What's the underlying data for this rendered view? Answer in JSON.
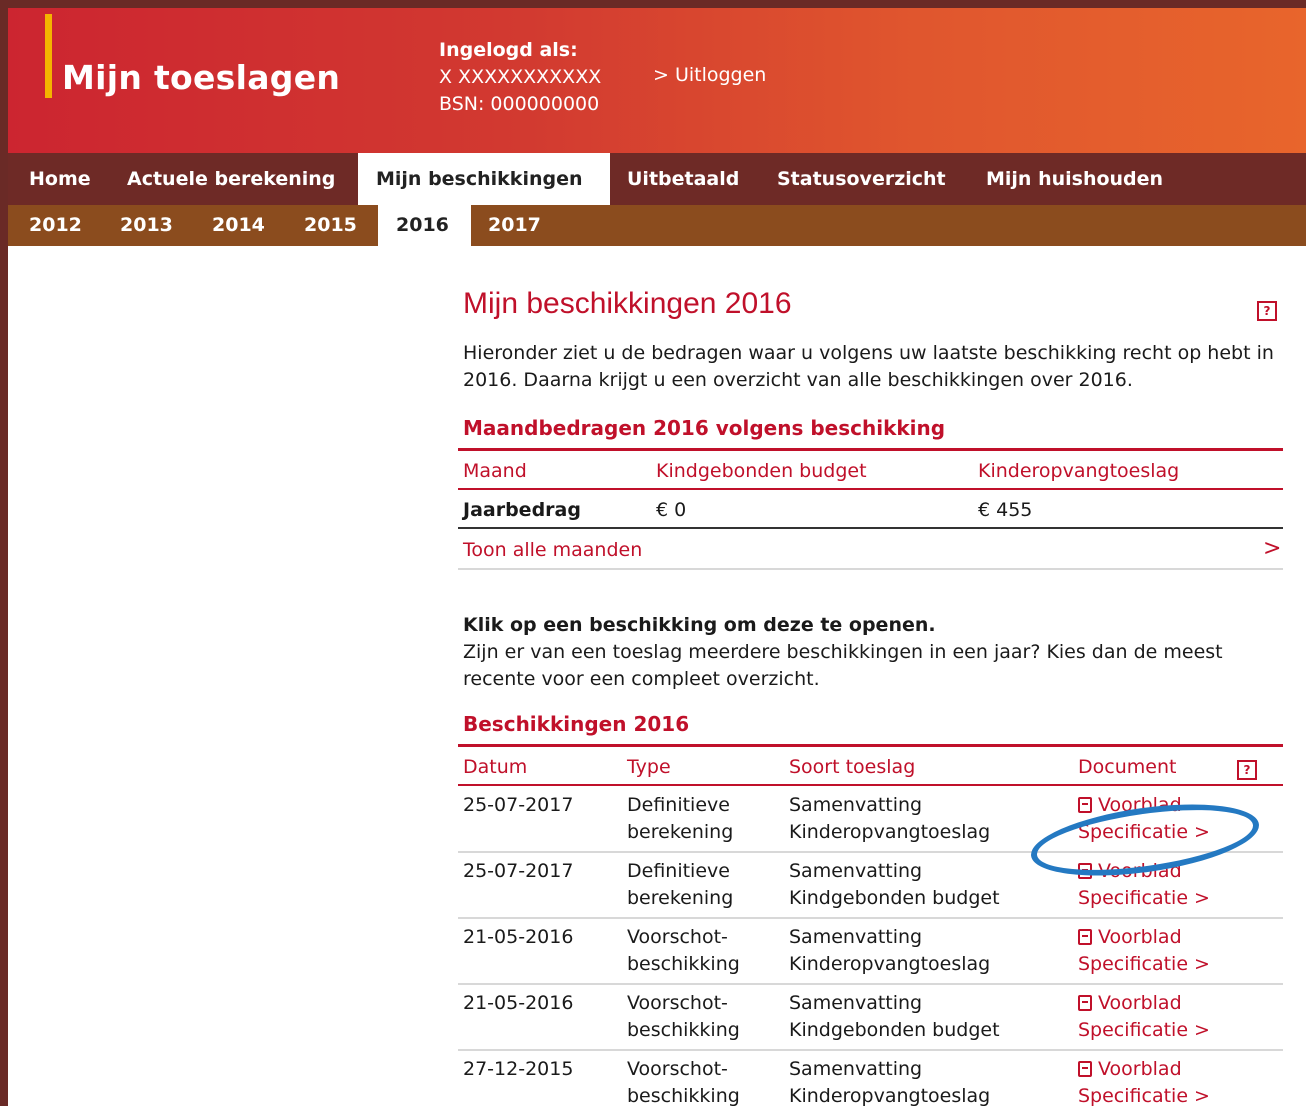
{
  "header": {
    "brand": "Mijn toeslagen",
    "login_label": "Ingelogd als:",
    "login_name": "X XXXXXXXXXXX",
    "login_bsn": "BSN: 000000000",
    "logout": "> Uitloggen"
  },
  "nav": {
    "main": [
      "Home",
      "Actuele berekening",
      "Mijn beschikkingen",
      "Uitbetaald",
      "Statusoverzicht",
      "Mijn huishouden"
    ],
    "active_main": "Mijn beschikkingen",
    "years": [
      "2012",
      "2013",
      "2014",
      "2015",
      "2016",
      "2017"
    ],
    "active_year": "2016"
  },
  "content": {
    "title": "Mijn beschikkingen 2016",
    "intro": "Hieronder ziet u de bedragen waar u volgens uw laatste beschikking recht op hebt in 2016. Daarna krijgt u een overzicht van alle beschikkingen over 2016.",
    "help_icon": "?",
    "month_section": {
      "title": "Maandbedragen 2016 volgens beschikking",
      "headers": [
        "Maand",
        "Kindgebonden budget",
        "Kinderopvangtoeslag"
      ],
      "row": [
        "Jaarbedrag",
        "€ 0",
        "€ 455"
      ],
      "show_all": "Toon alle maanden",
      "chevron": ">"
    },
    "instruction_heading": "Klik op een beschikking om deze te openen.",
    "instruction_body": "Zijn er van een toeslag meerdere beschikkingen in een jaar? Kies dan de meest recente voor een compleet overzicht.",
    "beschikkingen": {
      "title": "Beschikkingen 2016",
      "headers": [
        "Datum",
        "Type",
        "Soort toeslag",
        "Document"
      ],
      "rows": [
        {
          "datum": "25-07-2017",
          "type1": "Definitieve",
          "type2": "berekening",
          "soort1": "Samenvatting",
          "soort2": "Kinderopvangtoeslag",
          "doc1": "Voorblad",
          "doc2": "Specificatie >"
        },
        {
          "datum": "25-07-2017",
          "type1": "Definitieve",
          "type2": "berekening",
          "soort1": "Samenvatting",
          "soort2": "Kindgebonden budget",
          "doc1": "Voorblad",
          "doc2": "Specificatie >"
        },
        {
          "datum": "21-05-2016",
          "type1": "Voorschot-",
          "type2": "beschikking",
          "soort1": "Samenvatting",
          "soort2": "Kinderopvangtoeslag",
          "doc1": "Voorblad",
          "doc2": "Specificatie >"
        },
        {
          "datum": "21-05-2016",
          "type1": "Voorschot-",
          "type2": "beschikking",
          "soort1": "Samenvatting",
          "soort2": "Kindgebonden budget",
          "doc1": "Voorblad",
          "doc2": "Specificatie >"
        },
        {
          "datum": "27-12-2015",
          "type1": "Voorschot-",
          "type2": "beschikking",
          "soort1": "Samenvatting",
          "soort2": "Kinderopvangtoeslag",
          "doc1": "Voorblad",
          "doc2": "Specificatie >"
        }
      ]
    }
  },
  "colors": {
    "accent": "#c0102a",
    "annotation": "#2479c2",
    "nav_main": "#6e2a26",
    "nav_year": "#8b4c1e"
  }
}
